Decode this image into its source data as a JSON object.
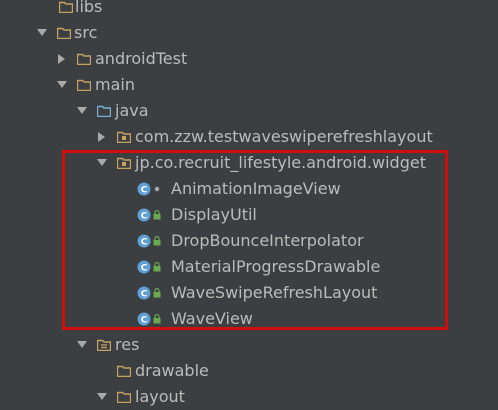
{
  "tree": {
    "rows": [
      {
        "label": "libs",
        "kind": "folder",
        "expanded": null
      },
      {
        "label": "src",
        "kind": "folder",
        "expanded": true
      },
      {
        "label": "androidTest",
        "kind": "folder",
        "expanded": false
      },
      {
        "label": "main",
        "kind": "folder",
        "expanded": true
      },
      {
        "label": "java",
        "kind": "source-folder",
        "expanded": true
      },
      {
        "label": "com.zzw.testwaveswiperefreshlayout",
        "kind": "package",
        "expanded": false
      },
      {
        "label": "jp.co.recruit_lifestyle.android.widget",
        "kind": "package",
        "expanded": true
      },
      {
        "label": "AnimationImageView",
        "kind": "class",
        "access": "package-private"
      },
      {
        "label": "DisplayUtil",
        "kind": "class",
        "access": "public"
      },
      {
        "label": "DropBounceInterpolator",
        "kind": "class",
        "access": "public"
      },
      {
        "label": "MaterialProgressDrawable",
        "kind": "class",
        "access": "public"
      },
      {
        "label": "WaveSwipeRefreshLayout",
        "kind": "class",
        "access": "public"
      },
      {
        "label": "WaveView",
        "kind": "class",
        "access": "public"
      },
      {
        "label": "res",
        "kind": "resource-folder",
        "expanded": true
      },
      {
        "label": "drawable",
        "kind": "folder",
        "expanded": null
      },
      {
        "label": "layout",
        "kind": "folder",
        "expanded": true
      }
    ]
  },
  "colors": {
    "background": "#3c3f41",
    "text": "#bbbbbb",
    "folder": "#c6a263",
    "source_folder": "#7ab0d8",
    "class_badge": "#5f9fd6",
    "lock": "#6aaa4e",
    "highlight_border": "#d10e0e"
  },
  "icons": {
    "expanded": "triangle-down-icon",
    "collapsed": "triangle-right-icon",
    "folder": "folder-icon",
    "package": "package-icon",
    "class": "class-c-icon",
    "public_access": "lock-icon",
    "package_access": "dot-icon"
  }
}
